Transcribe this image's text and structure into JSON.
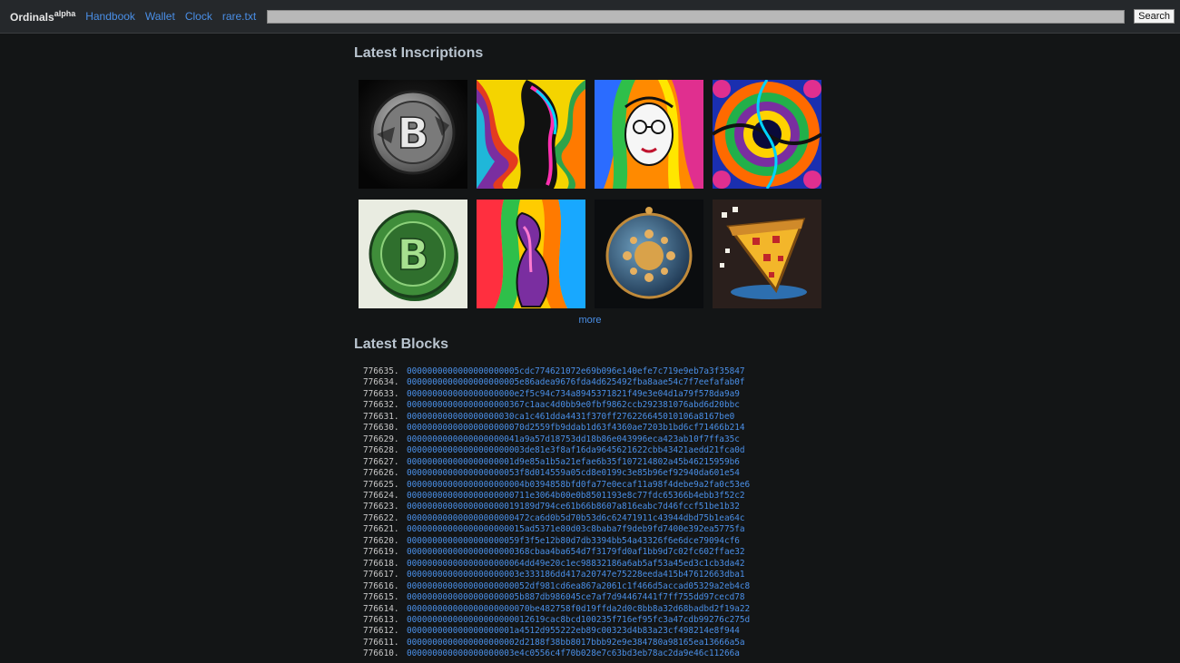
{
  "nav": {
    "brand": "Ordinals",
    "brand_sup": "alpha",
    "links": [
      "Handbook",
      "Wallet",
      "Clock",
      "rare.txt"
    ],
    "search_placeholder": "",
    "search_button": "Search"
  },
  "inscriptions": {
    "title": "Latest Inscriptions",
    "more": "more",
    "items": [
      {
        "icon": "bitcoin-stone-coin"
      },
      {
        "icon": "psychedelic-woman-profile"
      },
      {
        "icon": "psychedelic-woman-glasses"
      },
      {
        "icon": "symmetric-fractal"
      },
      {
        "icon": "green-bitcoin-coin"
      },
      {
        "icon": "psychedelic-figure"
      },
      {
        "icon": "golden-globe-coin"
      },
      {
        "icon": "pixel-pizza-slice"
      }
    ]
  },
  "blocks": {
    "title": "Latest Blocks",
    "items": [
      {
        "height": "776635.",
        "hash": "0000000000000000000005cdc774621072e69b096e140efe7c719e9eb7a3f35847"
      },
      {
        "height": "776634.",
        "hash": "0000000000000000000005e86adea9676fda4d625492fba8aae54c7f7eefafab0f"
      },
      {
        "height": "776633.",
        "hash": "000000000000000000000e2f5c94c734a8945371821f49e3e04d1a79f578da9a9"
      },
      {
        "height": "776632.",
        "hash": "00000000000000000000367c1aac4d0bb9e0fbf9862ccb292381076abd6d20bbc"
      },
      {
        "height": "776631.",
        "hash": "000000000000000000030ca1c461dda4431f370ff276226645010106a8167be0"
      },
      {
        "height": "776630.",
        "hash": "00000000000000000000070d2559fb9ddab1d63f4360ae7203b1bd6cf71466b214"
      },
      {
        "height": "776629.",
        "hash": "0000000000000000000041a9a57d18753dd18b86e043996eca423ab10f7ffa35c"
      },
      {
        "height": "776628.",
        "hash": "00000000000000000000003de81e3f8af16da9645621622cbb43421aedd21fca0d"
      },
      {
        "height": "776627.",
        "hash": "000000000000000000001d9e85a1b5a21efae6b35f107214802a45b46215959b6"
      },
      {
        "height": "776626.",
        "hash": "0000000000000000000053f8d014559a05cd8e0199c3e85b96ef92940da601e54"
      },
      {
        "height": "776625.",
        "hash": "00000000000000000000004b0394858bfd0fa77e0ecaf11a98f4debe9a2fa0c53e6"
      },
      {
        "height": "776624.",
        "hash": "000000000000000000000711e3064b00e0b8501193e8c77fdc65366b4ebb3f52c2"
      },
      {
        "height": "776623.",
        "hash": "0000000000000000000019189d794ce61b66b8607a816eabc7d46fccf51be1b32"
      },
      {
        "height": "776622.",
        "hash": "000000000000000000000472ca6d0b5d70b53d6c62471911c43944dbd75b1ea64c"
      },
      {
        "height": "776621.",
        "hash": "00000000000000000000015ad5371e80d03c8baba7f9deb9fd7400e392ea5775fa"
      },
      {
        "height": "776620.",
        "hash": "0000000000000000000059f3f5e12b80d7db3394bb54a43326f6e6dce79094cf6"
      },
      {
        "height": "776619.",
        "hash": "000000000000000000000368cbaa4ba654d7f3179fd0af1bb9d7c02fc602ffae32"
      },
      {
        "height": "776618.",
        "hash": "00000000000000000000064dd49e20c1ec98832186a6ab5af53a45ed3c1cb3da42"
      },
      {
        "height": "776617.",
        "hash": "0000000000000000000003e333186dd417a20747e75228eeda415b47612663dba1"
      },
      {
        "height": "776616.",
        "hash": "000000000000000000000052df981cd6ea867a2061c1f466d5accad05329a2eb4c8"
      },
      {
        "height": "776615.",
        "hash": "0000000000000000000005b887db986045ce7af7d94467441f7ff755dd97cecd78"
      },
      {
        "height": "776614.",
        "hash": "000000000000000000000070be482758f0d19ffda2d0c8bb8a32d68badbd2f19a22"
      },
      {
        "height": "776613.",
        "hash": "000000000000000000000012619cac8bcd100235f716ef95fc3a47cdb99276c275d"
      },
      {
        "height": "776612.",
        "hash": "000000000000000000001a4512d955222eb89c00323d4b83a23cf498214e8f944"
      },
      {
        "height": "776611.",
        "hash": "0000000000000000000002d2188f38bb8017bbb92e9e384780a98165ea13666a5a"
      },
      {
        "height": "776610.",
        "hash": "000000000000000000003e4c0556c4f70b028e7c63bd3eb78ac2da9e46c11266a"
      }
    ]
  }
}
